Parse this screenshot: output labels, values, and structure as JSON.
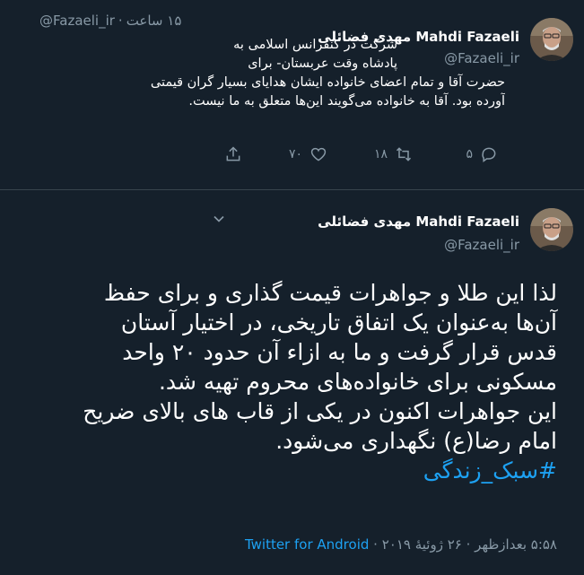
{
  "tweet1": {
    "display_name": "Mahdi Fazaeli مهدی فضائلی",
    "handle": "@Fazaeli_ir",
    "handle_truncated": "@Fazaeli_ir",
    "time": "۱۵ ساعت",
    "lines": [
      "شرکت در کنفرانس اسلامی به",
      "پادشاه وقت عربستان- برای",
      "حضرت آقا و تمام اعضای خانواده ایشان هدایای بسیار گران قیمتی",
      "آورده بود. آقا به خانواده می‌گویند این‌ها متعلق به ما نیست."
    ],
    "replies": "۵",
    "retweets": "۱۸",
    "likes": "۷۰"
  },
  "tweet2": {
    "display_name": "Mahdi Fazaeli مهدی فضائلی",
    "handle": "@Fazaeli_ir",
    "body_lines": [
      "لذا این طلا و جواهرات قیمت گذاری و برای حفظ",
      "آن‌ها به‌عنوان یک اتفاق تاریخی، در اختیار آستان",
      "قدس قرار گرفت و ما به ازاء آن حدود ۲۰ واحد",
      "مسکونی برای خانواده‌های محروم تهیه شد.",
      "این جواهرات اکنون در یکی از قاب های بالای ضریح",
      "امام رضا(ع) نگهداری می‌شود."
    ],
    "hashtag": "#سبک_زندگی",
    "timestamp": "۵:۵۸ بعدازظهر · ۲۶ ژوئیهٔ ۲۰۱۹ ·",
    "source": "Twitter for Android"
  }
}
